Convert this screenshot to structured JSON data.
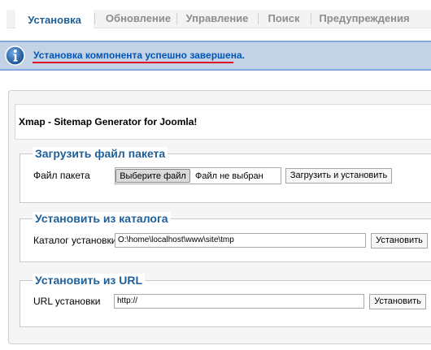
{
  "tabs": [
    {
      "label": "Установка",
      "active": true
    },
    {
      "label": "Обновление",
      "active": false
    },
    {
      "label": "Управление",
      "active": false
    },
    {
      "label": "Поиск",
      "active": false
    },
    {
      "label": "Предупреждения",
      "active": false
    }
  ],
  "message": {
    "icon": "info-icon",
    "text": "Установка компонента успешно завершена."
  },
  "extension_title": "Xmap - Sitemap Generator for Joomla!",
  "upload_package": {
    "legend": "Загрузить файл пакета",
    "field_label": "Файл пакета",
    "choose_button": "Выберите файл",
    "no_file_text": "Файл не выбран",
    "submit_button": "Загрузить и установить"
  },
  "install_from_dir": {
    "legend": "Установить из каталога",
    "field_label": "Каталог установки",
    "path_value": "O:\\home\\localhost\\www\\site\\tmp",
    "submit_button": "Установить"
  },
  "install_from_url": {
    "legend": "Установить из URL",
    "field_label": "URL установки",
    "url_value": "http://",
    "submit_button": "Установить"
  },
  "colors": {
    "tab_active": "#1f5f97",
    "message_bg": "#c3d2e5",
    "message_text": "#0055bb",
    "underline": "#e0112b"
  }
}
